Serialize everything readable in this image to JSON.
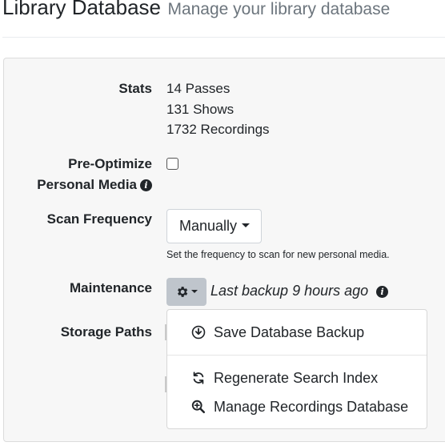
{
  "header": {
    "title": "Library Database",
    "subtitle": "Manage your library database"
  },
  "stats": {
    "label": "Stats",
    "lines": [
      "14 Passes",
      "131 Shows",
      "1732 Recordings"
    ]
  },
  "pre_optimize": {
    "label_line1": "Pre-Optimize",
    "label_line2": "Personal Media",
    "checked": false,
    "info_icon": "info-circle-icon"
  },
  "scan_frequency": {
    "label": "Scan Frequency",
    "selected": "Manually",
    "help": "Set the frequency to scan for new personal media."
  },
  "maintenance": {
    "label": "Maintenance",
    "gear_icon": "gear-icon",
    "last_backup": "Last backup 9 hours ago",
    "menu": [
      {
        "label": "Save Database Backup",
        "icon": "download-circle-icon"
      },
      {
        "label": "Regenerate Search Index",
        "icon": "sync-icon"
      },
      {
        "label": "Manage Recordings Database",
        "icon": "search-plus-icon"
      }
    ]
  },
  "storage_paths": {
    "label": "Storage Paths"
  },
  "colors": {
    "gear_button_bg": "#bfc5cc",
    "panel_bg": "#f7f7f7",
    "subtitle": "#6c757d"
  }
}
